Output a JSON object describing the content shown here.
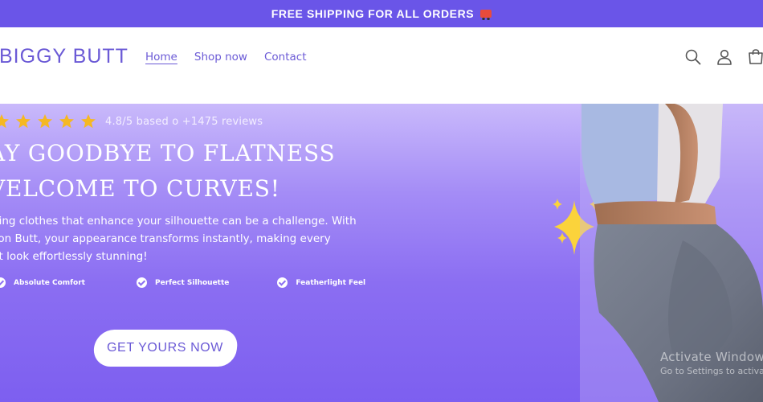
{
  "announcement": {
    "text": "FREE SHIPPING FOR ALL ORDERS"
  },
  "brand": {
    "name": "BIGGY BUTT"
  },
  "nav": {
    "items": [
      {
        "label": "Home",
        "active": true
      },
      {
        "label": "Shop now",
        "active": false
      },
      {
        "label": "Contact",
        "active": false
      }
    ]
  },
  "header_icons": [
    "search-icon",
    "account-icon",
    "cart-icon"
  ],
  "hero": {
    "rating": {
      "stars": 5,
      "text": "4.8/5 based o +1475 reviews"
    },
    "headline_line1": "AY GOODBYE TO FLATNESS",
    "headline_line2": "VELCOME TO CURVES!",
    "body_line1": "ding clothes that enhance your silhouette can be a challenge. With",
    "body_line2": "con Butt, your appearance transforms instantly, making every",
    "body_line3": "fit look effortlessly stunning!",
    "features": [
      "Absolute Comfort",
      "Perfect Silhouette",
      "Featherlight Feel"
    ],
    "cta_label": "GET YOURS NOW"
  },
  "os_watermark": {
    "line1": "Activate Windows",
    "line2": "Go to Settings to activate Windows."
  },
  "colors": {
    "brand": "#6b5ad6",
    "announce_bg": "#6a55e8",
    "star": "#f5b823",
    "hero_top": "#c9b9fb",
    "hero_bottom": "#7d5ff0"
  }
}
